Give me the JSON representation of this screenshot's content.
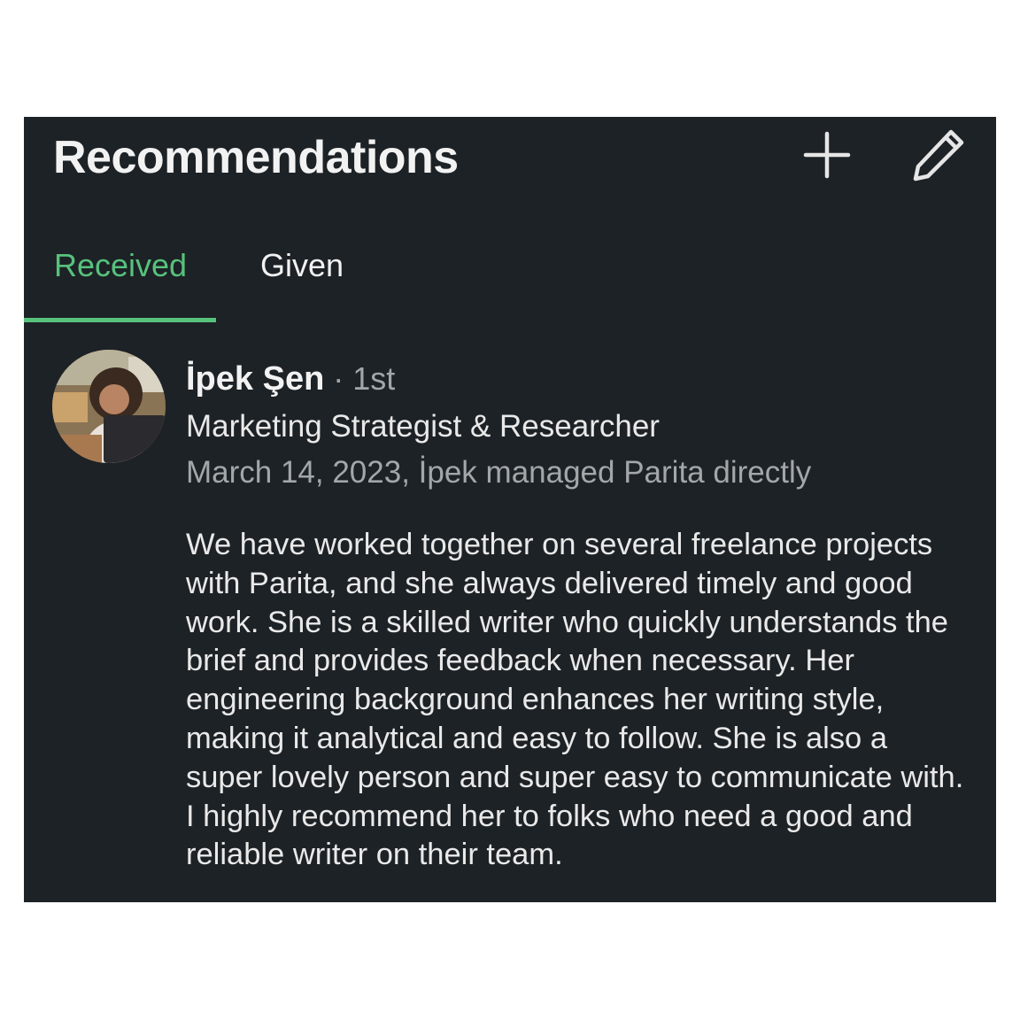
{
  "header": {
    "title": "Recommendations",
    "add_icon": "plus-icon",
    "edit_icon": "pencil-icon"
  },
  "tabs": [
    {
      "label": "Received",
      "active": true
    },
    {
      "label": "Given",
      "active": false
    }
  ],
  "colors": {
    "accent": "#57c27c",
    "panel_background": "#1d2226",
    "secondary_text": "#a3a7aa"
  },
  "recommendation": {
    "name": "İpek Şen",
    "degree": " · 1st",
    "headline": "Marketing Strategist & Researcher",
    "meta": "March 14, 2023, İpek managed Parita directly",
    "text": "We have worked together on several freelance projects with Parita, and she always delivered timely and good work. She is a skilled writer who quickly understands the brief and provides feedback when necessary. Her engineering background enhances her writing style, making it analytical and easy to follow. She is also a super lovely person and super easy to communicate with. I highly recommend her to folks who need a good and reliable writer on their team."
  }
}
